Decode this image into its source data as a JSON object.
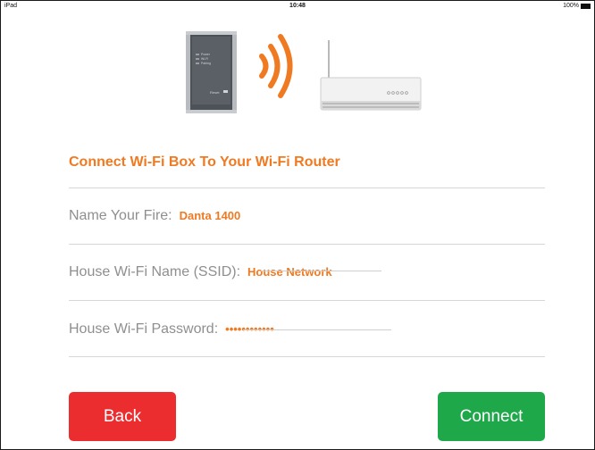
{
  "status_bar": {
    "device": "iPad",
    "time": "10:48",
    "battery": "100%"
  },
  "illustration": {
    "box_lines": [
      "Power",
      "Wi-Fi",
      "Pairing"
    ],
    "box_label": "Reset",
    "signal_icon": "wifi-signal-icon",
    "router_icon": "router-icon",
    "accent_color": "#ef7a22"
  },
  "form": {
    "title": "Connect Wi-Fi Box To Your Wi-Fi Router",
    "fields": [
      {
        "label": "Name Your Fire:",
        "value": "Danta 1400"
      },
      {
        "label": "House Wi-Fi Name (SSID):",
        "value": "House Network"
      },
      {
        "label": "House Wi-Fi Password:",
        "value": "••••••••••••"
      }
    ]
  },
  "buttons": {
    "back": "Back",
    "connect": "Connect"
  },
  "colors": {
    "accent": "#ef7a22",
    "back": "#ec2d2f",
    "connect": "#1fa84a"
  }
}
